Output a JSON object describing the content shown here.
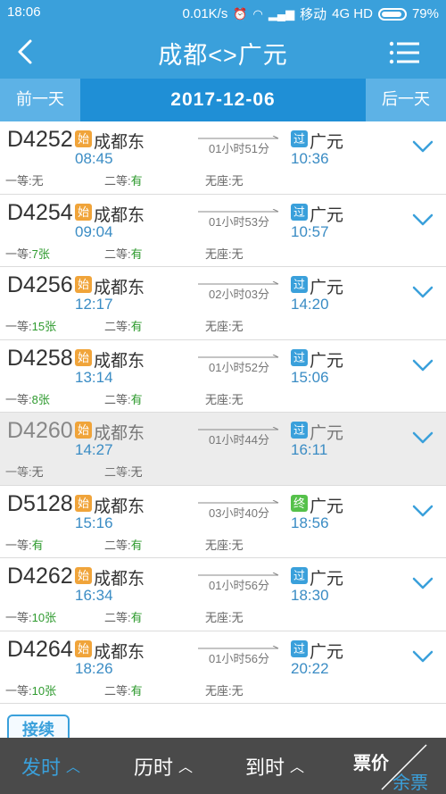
{
  "status": {
    "time": "18:06",
    "speed": "0.01K/s",
    "carrier": "移动",
    "network": "4G HD",
    "battery": "79%"
  },
  "header": {
    "title": "成都<>广元",
    "back_icon": "back-arrow-icon",
    "menu_icon": "menu-icon"
  },
  "datebar": {
    "prev": "前一天",
    "date": "2017-12-06",
    "next": "后一天"
  },
  "badges": {
    "start": "始",
    "pass": "过",
    "end": "终"
  },
  "seat_labels": {
    "first": "一等:",
    "second": "二等:",
    "noseat": "无座:"
  },
  "trains": [
    {
      "no": "D4252",
      "from": "成都东",
      "to": "广元",
      "dep": "08:45",
      "arr": "10:36",
      "duration": "01小时51分",
      "type": "pass",
      "first": "无",
      "second": "有",
      "noseat": "无"
    },
    {
      "no": "D4254",
      "from": "成都东",
      "to": "广元",
      "dep": "09:04",
      "arr": "10:57",
      "duration": "01小时53分",
      "type": "pass",
      "first": "7张",
      "second": "有",
      "noseat": "无"
    },
    {
      "no": "D4256",
      "from": "成都东",
      "to": "广元",
      "dep": "12:17",
      "arr": "14:20",
      "duration": "02小时03分",
      "type": "pass",
      "first": "15张",
      "second": "有",
      "noseat": "无"
    },
    {
      "no": "D4258",
      "from": "成都东",
      "to": "广元",
      "dep": "13:14",
      "arr": "15:06",
      "duration": "01小时52分",
      "type": "pass",
      "first": "8张",
      "second": "有",
      "noseat": "无"
    },
    {
      "no": "D4260",
      "from": "成都东",
      "to": "广元",
      "dep": "14:27",
      "arr": "16:11",
      "duration": "01小时44分",
      "type": "pass",
      "first": "无",
      "second": "无",
      "noseat": "",
      "disabled": true
    },
    {
      "no": "D5128",
      "from": "成都东",
      "to": "广元",
      "dep": "15:16",
      "arr": "18:56",
      "duration": "03小时40分",
      "type": "end",
      "first": "有",
      "second": "有",
      "noseat": "无"
    },
    {
      "no": "D4262",
      "from": "成都东",
      "to": "广元",
      "dep": "16:34",
      "arr": "18:30",
      "duration": "01小时56分",
      "type": "pass",
      "first": "10张",
      "second": "有",
      "noseat": "无"
    },
    {
      "no": "D4264",
      "from": "成都东",
      "to": "广元",
      "dep": "18:26",
      "arr": "20:22",
      "duration": "01小时56分",
      "type": "pass",
      "first": "10张",
      "second": "有",
      "noseat": "无"
    }
  ],
  "connect_label": "接续",
  "bottom": {
    "sort_depart": "发时",
    "sort_duration": "历时",
    "sort_arrive": "到时",
    "toggle_price": "票价",
    "toggle_remain": "余票"
  },
  "colors": {
    "primary": "#3aa0db",
    "datebar": "#1f8fd6",
    "available": "#2e9a2e",
    "start_badge": "#f0a43a",
    "end_badge": "#55c14a"
  }
}
